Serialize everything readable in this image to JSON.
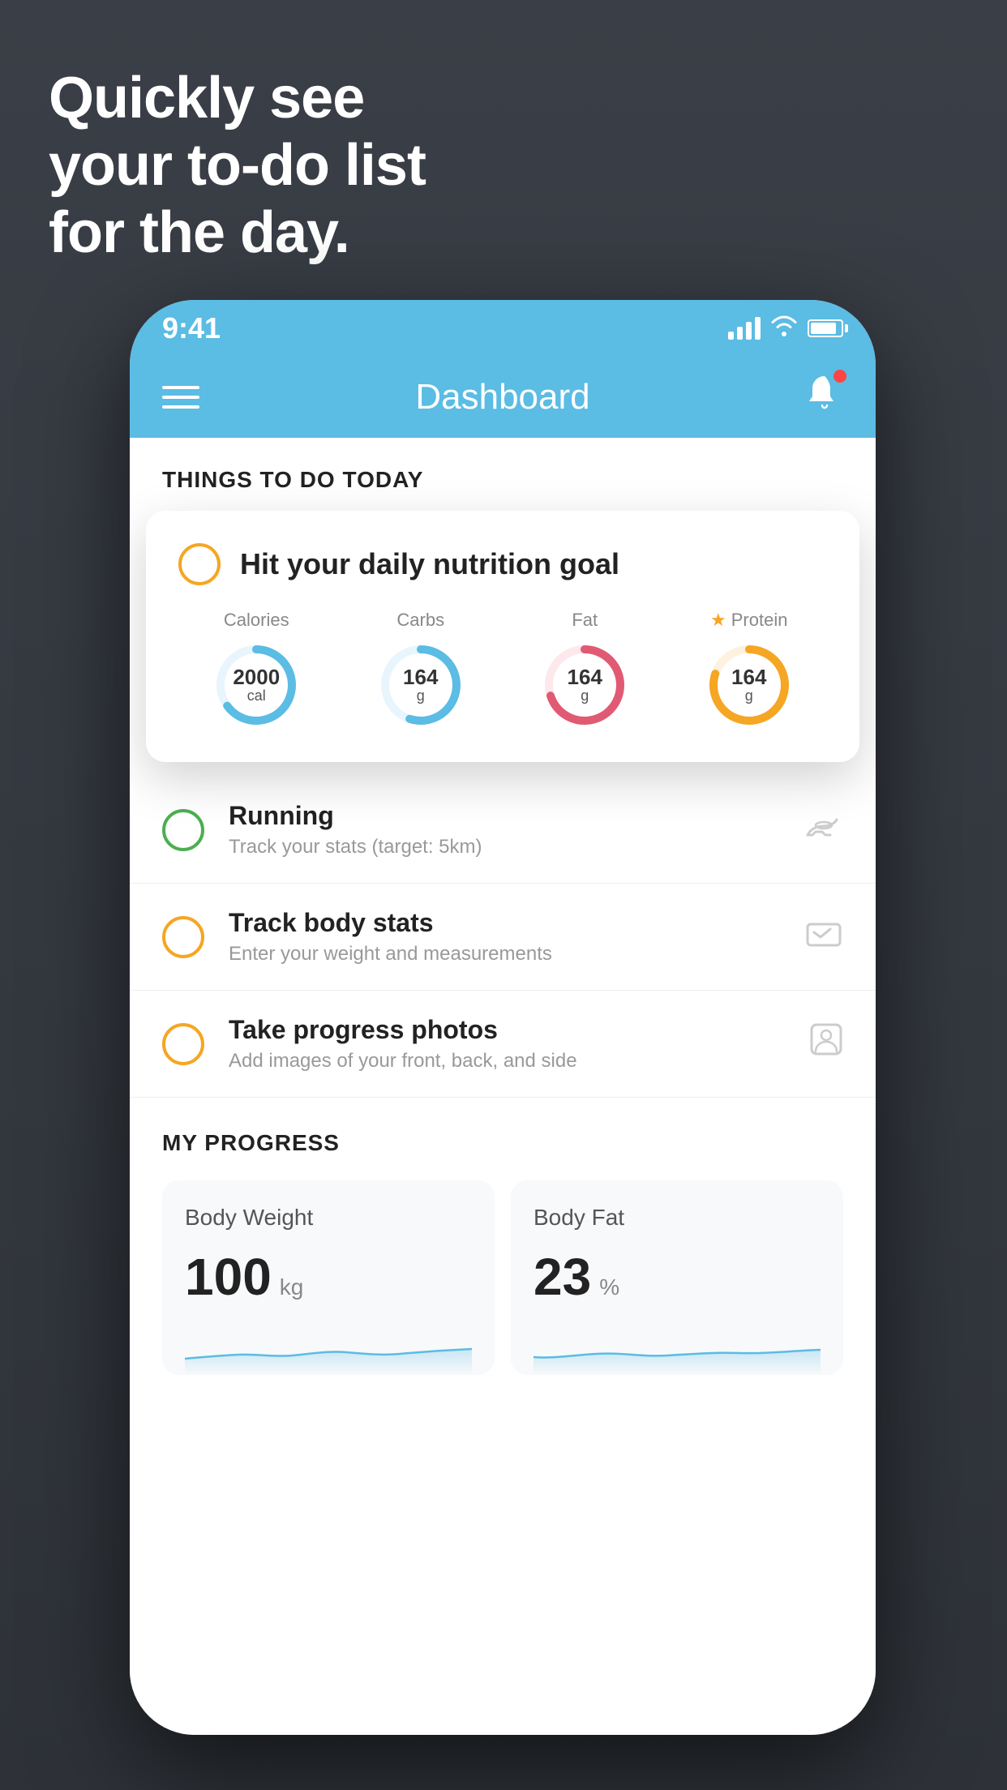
{
  "background_color": "#3a3f47",
  "hero": {
    "line1": "Quickly see",
    "line2": "your to-do list",
    "line3": "for the day."
  },
  "status_bar": {
    "time": "9:41",
    "signal_bars": [
      10,
      16,
      22,
      28
    ],
    "wifi": "wifi",
    "battery": "battery"
  },
  "nav": {
    "title": "Dashboard",
    "menu": "menu",
    "bell": "bell"
  },
  "things_today": {
    "header": "THINGS TO DO TODAY"
  },
  "nutrition_card": {
    "title": "Hit your daily nutrition goal",
    "stats": [
      {
        "label": "Calories",
        "value": "2000",
        "unit": "cal",
        "color": "#5bbce4",
        "percent": 65,
        "starred": false
      },
      {
        "label": "Carbs",
        "value": "164",
        "unit": "g",
        "color": "#5bbce4",
        "percent": 55,
        "starred": false
      },
      {
        "label": "Fat",
        "value": "164",
        "unit": "g",
        "color": "#e05a73",
        "percent": 70,
        "starred": false
      },
      {
        "label": "Protein",
        "value": "164",
        "unit": "g",
        "color": "#f5a623",
        "percent": 80,
        "starred": true
      }
    ]
  },
  "todo_items": [
    {
      "title": "Running",
      "subtitle": "Track your stats (target: 5km)",
      "circle_color": "green",
      "icon": "👟"
    },
    {
      "title": "Track body stats",
      "subtitle": "Enter your weight and measurements",
      "circle_color": "yellow",
      "icon": "⚖️"
    },
    {
      "title": "Take progress photos",
      "subtitle": "Add images of your front, back, and side",
      "circle_color": "yellow",
      "icon": "👤"
    }
  ],
  "progress": {
    "header": "MY PROGRESS",
    "cards": [
      {
        "title": "Body Weight",
        "value": "100",
        "unit": "kg"
      },
      {
        "title": "Body Fat",
        "value": "23",
        "unit": "%"
      }
    ]
  }
}
